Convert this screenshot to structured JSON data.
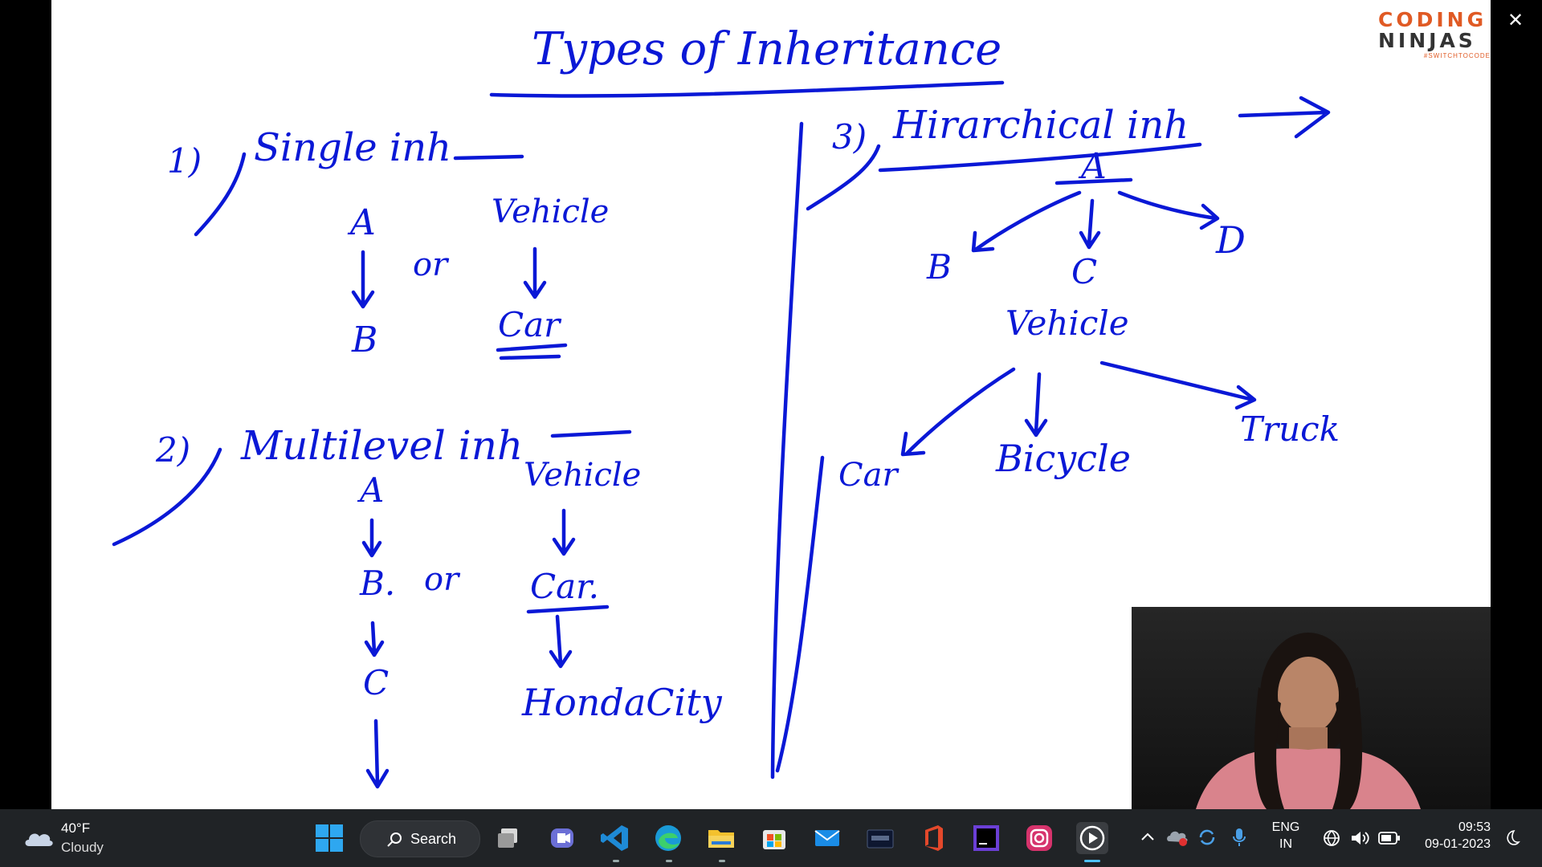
{
  "whiteboard": {
    "title": "Types of Inheritance",
    "section1": {
      "number": "1)",
      "heading": "Single inh",
      "left_top": "A",
      "left_bottom": "B",
      "or": "or",
      "right_top": "Vehicle",
      "right_bottom": "Car"
    },
    "section2": {
      "number": "2)",
      "heading": "Multilevel inh",
      "left": [
        "A",
        "B.",
        "C"
      ],
      "or": "or",
      "right": [
        "Vehicle",
        "Car.",
        "HondaCity"
      ]
    },
    "section3": {
      "number": "3)",
      "heading": "Hirarchical inh",
      "root": "A",
      "children": [
        "B",
        "C",
        "D"
      ],
      "root2": "Vehicle",
      "children2": [
        "Car",
        "Bicycle",
        "Truck"
      ]
    }
  },
  "logo": {
    "line1": "CODING",
    "line2": "NINJAS",
    "tagline": "#SWITCHTOCODE"
  },
  "window": {
    "close_symbol": "✕"
  },
  "taskbar": {
    "weather": {
      "temp": "40°F",
      "desc": "Cloudy",
      "icon": "cloud-icon"
    },
    "search_label": "Search",
    "apps": [
      "start-icon",
      "search-icon",
      "task-view-icon",
      "teams-icon",
      "vscode-icon",
      "edge-icon",
      "file-explorer-icon",
      "store-icon",
      "mail-icon",
      "mysql-icon",
      "office-icon",
      "intellij-icon",
      "instagram-icon",
      "media-player-icon"
    ],
    "language": {
      "line1": "ENG",
      "line2": "IN"
    },
    "clock": {
      "time": "09:53",
      "date": "09-01-2023"
    }
  },
  "colors": {
    "ink": "#0a18d6",
    "taskbar": "#202326",
    "logo_accent": "#e05a24"
  }
}
